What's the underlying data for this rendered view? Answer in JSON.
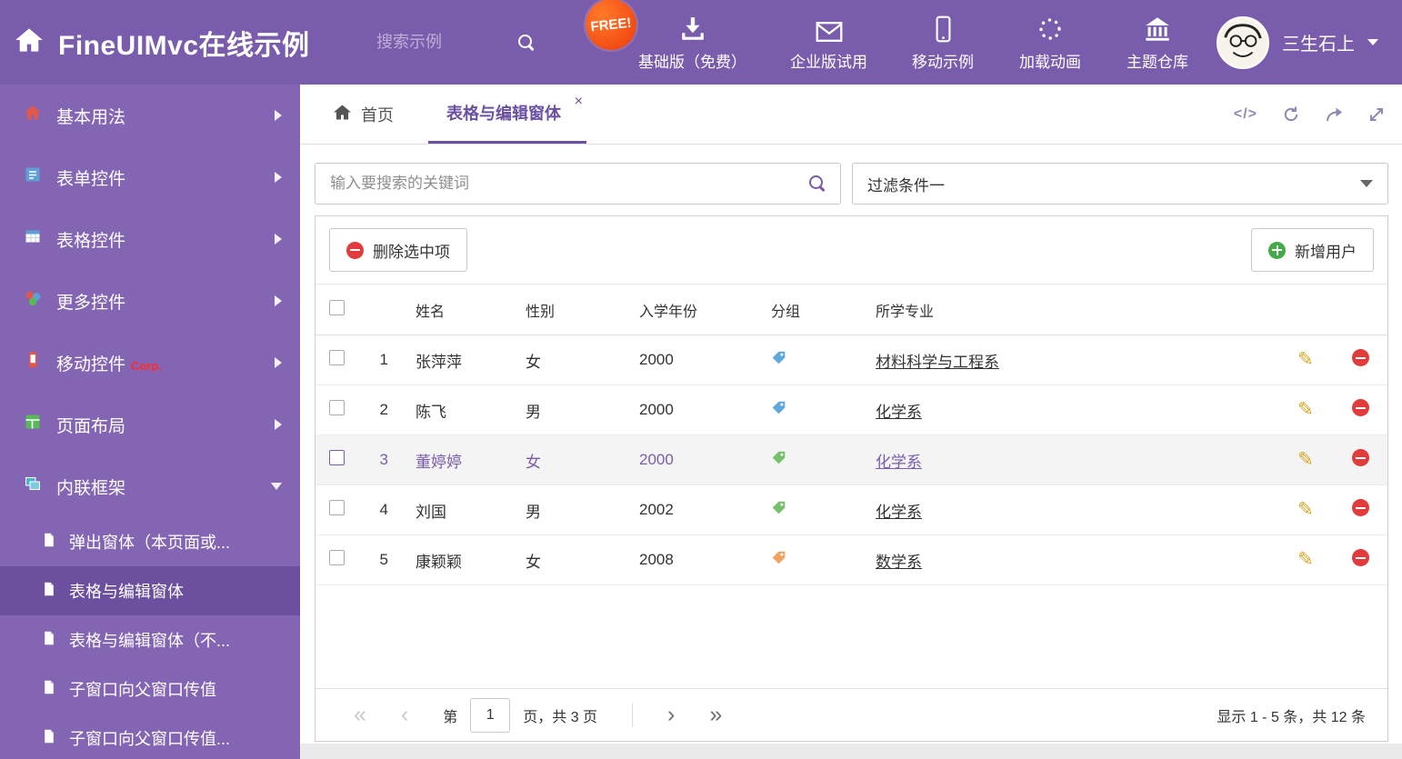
{
  "colors": {
    "header_bg": "#7a5cad",
    "sidebar_bg": "#8465b4",
    "sidebar_active_bg": "#6c4f9e",
    "accent_purple": "#6b4fa3",
    "selected_row_text": "#7a5cad",
    "free_badge": "#ef3a0b",
    "tag_blue": "#5fa8dc",
    "tag_green": "#76bf6b",
    "tag_orange": "#f0a35e",
    "delete_red": "#e23b3b",
    "add_green": "#44a948",
    "pencil_yellow": "#d9a522"
  },
  "header": {
    "brand": "FineUIMvc在线示例",
    "search_placeholder": "搜索示例",
    "menu": [
      {
        "label": "基础版（免费）",
        "icon": "download-icon",
        "badge": "FREE!"
      },
      {
        "label": "企业版试用",
        "icon": "envelope-icon"
      },
      {
        "label": "移动示例",
        "icon": "mobile-icon"
      },
      {
        "label": "加载动画",
        "icon": "spinner-icon"
      },
      {
        "label": "主题仓库",
        "icon": "bank-icon"
      }
    ],
    "user": {
      "name": "三生石上"
    }
  },
  "sidebar": {
    "items": [
      {
        "label": "基本用法",
        "icon": "home-icon"
      },
      {
        "label": "表单控件",
        "icon": "form-icon"
      },
      {
        "label": "表格控件",
        "icon": "table-icon"
      },
      {
        "label": "更多控件",
        "icon": "widgets-icon"
      },
      {
        "label": "移动控件",
        "icon": "mobile-icon",
        "tag": "Corp."
      },
      {
        "label": "页面布局",
        "icon": "layout-icon"
      },
      {
        "label": "内联框架",
        "icon": "iframe-icon",
        "expanded": true
      }
    ],
    "subitems": [
      {
        "label": "弹出窗体（本页面或..."
      },
      {
        "label": "表格与编辑窗体",
        "active": true
      },
      {
        "label": "表格与编辑窗体（不..."
      },
      {
        "label": "子窗口向父窗口传值"
      },
      {
        "label": "子窗口向父窗口传值..."
      }
    ]
  },
  "tabbar": {
    "home_tab": "首页",
    "active_tab": "表格与编辑窗体",
    "actions": [
      "code-icon",
      "refresh-icon",
      "share-icon",
      "expand-icon"
    ]
  },
  "filter": {
    "search_placeholder": "输入要搜索的关键词",
    "dropdown_value": "过滤条件一"
  },
  "toolbar": {
    "delete_label": "删除选中项",
    "add_label": "新增用户"
  },
  "table": {
    "columns": [
      "姓名",
      "性别",
      "入学年份",
      "分组",
      "所学专业"
    ],
    "rows": [
      {
        "num": "1",
        "name": "张萍萍",
        "gender": "女",
        "year": "2000",
        "tag_color": "#5fa8dc",
        "major": "材料科学与工程系",
        "selected": false
      },
      {
        "num": "2",
        "name": "陈飞",
        "gender": "男",
        "year": "2000",
        "tag_color": "#5fa8dc",
        "major": "化学系",
        "selected": false
      },
      {
        "num": "3",
        "name": "董婷婷",
        "gender": "女",
        "year": "2000",
        "tag_color": "#76bf6b",
        "major": "化学系",
        "selected": true
      },
      {
        "num": "4",
        "name": "刘国",
        "gender": "男",
        "year": "2002",
        "tag_color": "#76bf6b",
        "major": "化学系",
        "selected": false
      },
      {
        "num": "5",
        "name": "康颖颖",
        "gender": "女",
        "year": "2008",
        "tag_color": "#f0a35e",
        "major": "数学系",
        "selected": false
      }
    ]
  },
  "pagination": {
    "first": "«",
    "prev": "‹",
    "next": "›",
    "last": "»",
    "page_prefix": "第",
    "current_page": "1",
    "page_suffix": "页，共 3 页",
    "summary": "显示 1 - 5 条，共 12 条"
  }
}
